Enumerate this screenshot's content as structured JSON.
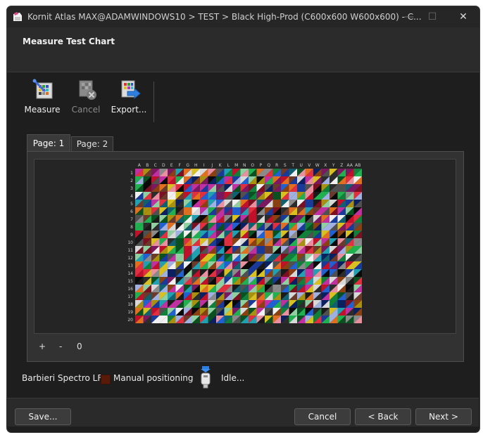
{
  "window": {
    "title": "Kornit Atlas MAX@ADAMWINDOWS10 > TEST > Black High-Prod (C600x600 W600x600) - C...",
    "app_icon": "kornit-app-icon",
    "controls": {
      "minimize": "—",
      "maximize": "☐",
      "close": "✕"
    }
  },
  "header": {
    "title": "Measure Test Chart"
  },
  "toolbar": {
    "measure_label": "Measure",
    "cancel_label": "Cancel",
    "export_label": "Export...",
    "measure_icon": "measure-icon",
    "cancel_icon": "cancel-icon",
    "export_icon": "export-icon"
  },
  "tabs": [
    {
      "label": "Page: 1",
      "active": true
    },
    {
      "label": "Page: 2",
      "active": false
    }
  ],
  "test_chart": {
    "columns": [
      "A",
      "B",
      "C",
      "D",
      "E",
      "F",
      "G",
      "H",
      "I",
      "J",
      "K",
      "L",
      "M",
      "N",
      "O",
      "P",
      "Q",
      "R",
      "S",
      "T",
      "U",
      "V",
      "W",
      "X",
      "Y",
      "Z",
      "AA",
      "AB"
    ],
    "rows": [
      "1",
      "2",
      "3",
      "4",
      "5",
      "6",
      "7",
      "8",
      "9",
      "10",
      "11",
      "12",
      "13",
      "14",
      "15",
      "16",
      "17",
      "18",
      "19",
      "20"
    ]
  },
  "zoom": {
    "plus": "+",
    "minus": "-",
    "value": "0"
  },
  "status": {
    "device": "Barbieri Spectro LFP",
    "mode": "Manual positioning",
    "state": "Idle...",
    "mode_color": "#5a1a0a",
    "usb_icon": "usb-device-icon"
  },
  "footer": {
    "save_label": "Save...",
    "cancel_label": "Cancel",
    "back_label": "< Back",
    "next_label": "Next >"
  }
}
